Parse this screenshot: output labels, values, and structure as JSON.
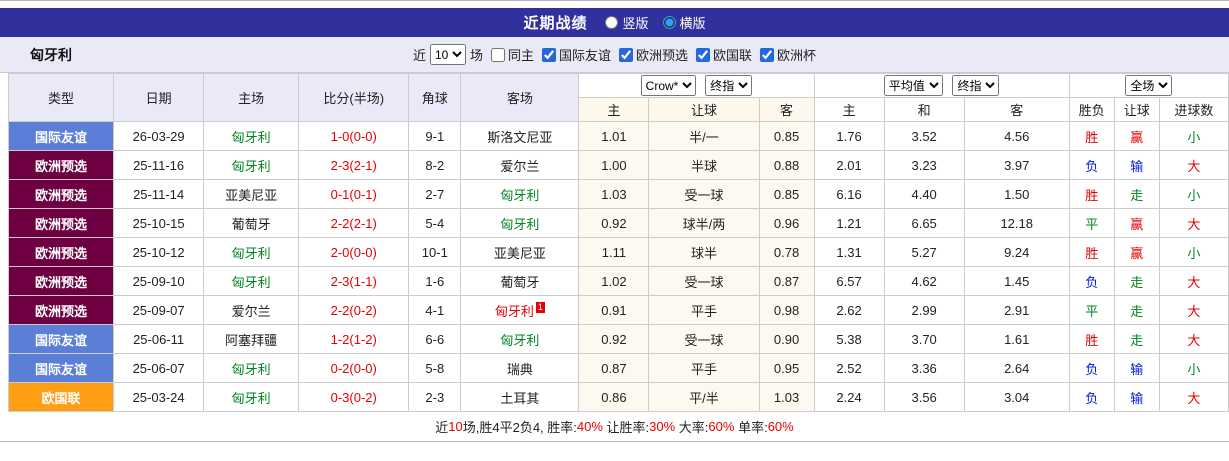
{
  "title_bar": {
    "title": "近期战绩",
    "radios": [
      {
        "label": "竖版",
        "selected": false
      },
      {
        "label": "横版",
        "selected": true
      }
    ]
  },
  "filter_bar": {
    "team": "匈牙利",
    "near_label": "近",
    "match_count": "10",
    "games_label": "场",
    "checkboxes": [
      {
        "label": "同主",
        "checked": false
      },
      {
        "label": "国际友谊",
        "checked": true
      },
      {
        "label": "欧洲预选",
        "checked": true
      },
      {
        "label": "欧国联",
        "checked": true
      },
      {
        "label": "欧洲杯",
        "checked": true
      }
    ]
  },
  "header": {
    "type": "类型",
    "date": "日期",
    "home": "主场",
    "score": "比分(半场)",
    "corner": "角球",
    "away": "客场",
    "odds_dropdown1": "Crow*",
    "odds_dropdown2": "终指",
    "odds_home": "主",
    "odds_handicap": "让球",
    "odds_away": "客",
    "europe_dropdown1": "平均值",
    "europe_dropdown2": "终指",
    "eu_home": "主",
    "eu_draw": "和",
    "eu_away": "客",
    "fulltime_dropdown": "全场",
    "result": "胜负",
    "handicap_result": "让球",
    "goals": "进球数"
  },
  "colors": {
    "accent_navy": "#31319e",
    "badge_blue": "#5b7ed7",
    "badge_maroon": "#6e0041",
    "badge_orange": "#ff9e15",
    "win_red": "#e60000",
    "lose_blue": "#0018d8",
    "draw_green": "#00851f"
  },
  "rows": [
    {
      "type": "国际友谊",
      "type_color": "blue",
      "date": "26-03-29",
      "home": "匈牙利",
      "home_color": "green",
      "score": "1-0(0-0)",
      "corner": "9-1",
      "away": "斯洛文尼亚",
      "away_color": "black",
      "odds": [
        "1.01",
        "半/一",
        "0.85"
      ],
      "europe": [
        "1.76",
        "3.52",
        "4.56"
      ],
      "result": "胜",
      "result_color": "red",
      "handicap": "赢",
      "handicap_color": "red",
      "goal": "小",
      "goal_color": "green"
    },
    {
      "type": "欧洲预选",
      "type_color": "maroon",
      "date": "25-11-16",
      "home": "匈牙利",
      "home_color": "green",
      "score": "2-3(2-1)",
      "corner": "8-2",
      "away": "爱尔兰",
      "away_color": "black",
      "odds": [
        "1.00",
        "半球",
        "0.88"
      ],
      "europe": [
        "2.01",
        "3.23",
        "3.97"
      ],
      "result": "负",
      "result_color": "blue",
      "handicap": "输",
      "handicap_color": "blue",
      "goal": "大",
      "goal_color": "red"
    },
    {
      "type": "欧洲预选",
      "type_color": "maroon",
      "date": "25-11-14",
      "home": "亚美尼亚",
      "home_color": "black",
      "score": "0-1(0-1)",
      "corner": "2-7",
      "away": "匈牙利",
      "away_color": "green",
      "odds": [
        "1.03",
        "受一球",
        "0.85"
      ],
      "europe": [
        "6.16",
        "4.40",
        "1.50"
      ],
      "result": "胜",
      "result_color": "red",
      "handicap": "走",
      "handicap_color": "green",
      "goal": "小",
      "goal_color": "green"
    },
    {
      "type": "欧洲预选",
      "type_color": "maroon",
      "date": "25-10-15",
      "home": "葡萄牙",
      "home_color": "black",
      "score": "2-2(2-1)",
      "corner": "5-4",
      "away": "匈牙利",
      "away_color": "green",
      "odds": [
        "0.92",
        "球半/两",
        "0.96"
      ],
      "europe": [
        "1.21",
        "6.65",
        "12.18"
      ],
      "result": "平",
      "result_color": "green",
      "handicap": "赢",
      "handicap_color": "red",
      "goal": "大",
      "goal_color": "red"
    },
    {
      "type": "欧洲预选",
      "type_color": "maroon",
      "date": "25-10-12",
      "home": "匈牙利",
      "home_color": "green",
      "score": "2-0(0-0)",
      "corner": "10-1",
      "away": "亚美尼亚",
      "away_color": "black",
      "odds": [
        "1.11",
        "球半",
        "0.78"
      ],
      "europe": [
        "1.31",
        "5.27",
        "9.24"
      ],
      "result": "胜",
      "result_color": "red",
      "handicap": "赢",
      "handicap_color": "red",
      "goal": "小",
      "goal_color": "green"
    },
    {
      "type": "欧洲预选",
      "type_color": "maroon",
      "date": "25-09-10",
      "home": "匈牙利",
      "home_color": "green",
      "score": "2-3(1-1)",
      "corner": "1-6",
      "away": "葡萄牙",
      "away_color": "black",
      "odds": [
        "1.02",
        "受一球",
        "0.87"
      ],
      "europe": [
        "6.57",
        "4.62",
        "1.45"
      ],
      "result": "负",
      "result_color": "blue",
      "handicap": "走",
      "handicap_color": "green",
      "goal": "大",
      "goal_color": "red"
    },
    {
      "type": "欧洲预选",
      "type_color": "maroon",
      "date": "25-09-07",
      "home": "爱尔兰",
      "home_color": "black",
      "score": "2-2(0-2)",
      "corner": "4-1",
      "away": "匈牙利",
      "away_color": "red",
      "away_badge": "1",
      "odds": [
        "0.91",
        "平手",
        "0.98"
      ],
      "europe": [
        "2.62",
        "2.99",
        "2.91"
      ],
      "result": "平",
      "result_color": "green",
      "handicap": "走",
      "handicap_color": "green",
      "goal": "大",
      "goal_color": "red"
    },
    {
      "type": "国际友谊",
      "type_color": "blue",
      "date": "25-06-11",
      "home": "阿塞拜疆",
      "home_color": "black",
      "score": "1-2(1-2)",
      "corner": "6-6",
      "away": "匈牙利",
      "away_color": "green",
      "odds": [
        "0.92",
        "受一球",
        "0.90"
      ],
      "europe": [
        "5.38",
        "3.70",
        "1.61"
      ],
      "result": "胜",
      "result_color": "red",
      "handicap": "走",
      "handicap_color": "green",
      "goal": "大",
      "goal_color": "red"
    },
    {
      "type": "国际友谊",
      "type_color": "blue",
      "date": "25-06-07",
      "home": "匈牙利",
      "home_color": "green",
      "score": "0-2(0-0)",
      "corner": "5-8",
      "away": "瑞典",
      "away_color": "black",
      "odds": [
        "0.87",
        "平手",
        "0.95"
      ],
      "europe": [
        "2.52",
        "3.36",
        "2.64"
      ],
      "result": "负",
      "result_color": "blue",
      "handicap": "输",
      "handicap_color": "blue",
      "goal": "小",
      "goal_color": "green"
    },
    {
      "type": "欧国联",
      "type_color": "orange",
      "date": "25-03-24",
      "home": "匈牙利",
      "home_color": "green",
      "score": "0-3(0-2)",
      "corner": "2-3",
      "away": "土耳其",
      "away_color": "black",
      "odds": [
        "0.86",
        "平/半",
        "1.03"
      ],
      "europe": [
        "2.24",
        "3.56",
        "3.04"
      ],
      "result": "负",
      "result_color": "blue",
      "handicap": "输",
      "handicap_color": "blue",
      "goal": "大",
      "goal_color": "red"
    }
  ],
  "footer": {
    "segments": [
      {
        "text": "近",
        "color": "black"
      },
      {
        "text": "10",
        "color": "red"
      },
      {
        "text": "场,胜4平2负4, 胜率:",
        "color": "black"
      },
      {
        "text": "40%",
        "color": "red"
      },
      {
        "text": " 让胜率:",
        "color": "black"
      },
      {
        "text": "30%",
        "color": "red"
      },
      {
        "text": " 大率:",
        "color": "black"
      },
      {
        "text": "60%",
        "color": "red"
      },
      {
        "text": " 单率:",
        "color": "black"
      },
      {
        "text": "60%",
        "color": "red"
      }
    ]
  }
}
